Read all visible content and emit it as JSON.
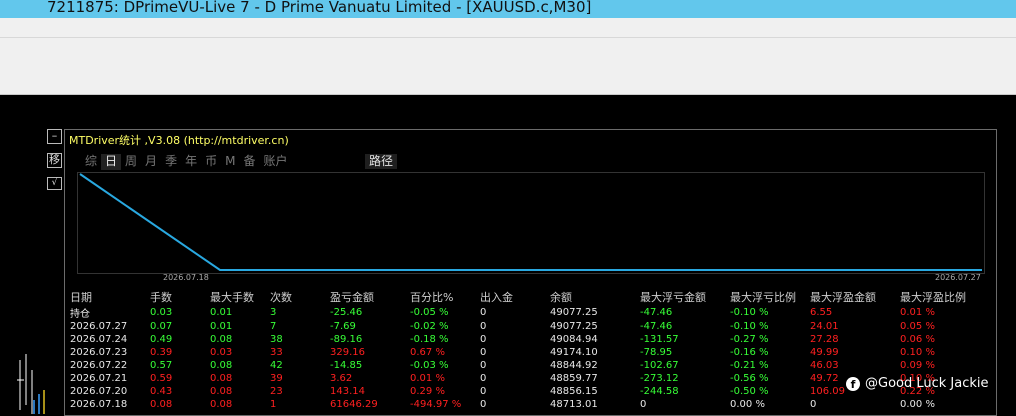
{
  "window": {
    "title": "7211875: DPrimeVU-Live 7 - D Prime Vanuatu Limited - [XAUUSD.c,M30]"
  },
  "side": {
    "minimize": "–",
    "move": "移",
    "check": "√"
  },
  "panel": {
    "title": "MTDriver统计 ,V3.08 (http://mtdriver.cn)",
    "tabs": [
      "综",
      "日",
      "周",
      "月",
      "季",
      "年",
      "币",
      "M",
      "备",
      "账户"
    ],
    "active_tab": "日",
    "path_button": "路径",
    "chart": {
      "start_label": "2026.07.18",
      "end_label": "2026.07.27",
      "line_color": "#29a8e0"
    }
  },
  "table": {
    "headers": [
      "日期",
      "手数",
      "最大手数",
      "次数",
      "盈亏金额",
      "百分比%",
      "出入金",
      "余额",
      "最大浮亏金额",
      "最大浮亏比例",
      "最大浮盈金额",
      "最大浮盈比例"
    ],
    "rows": [
      [
        "持仓",
        "0.03",
        "0.01",
        "3",
        "-25.46",
        "-0.05 %",
        "0",
        "49077.25",
        "-47.46",
        "-0.10 %",
        "6.55",
        "0.01 %"
      ],
      [
        "2026.07.27",
        "0.07",
        "0.01",
        "7",
        "-7.69",
        "-0.02 %",
        "0",
        "49077.25",
        "-47.46",
        "-0.10 %",
        "24.01",
        "0.05 %"
      ],
      [
        "2026.07.24",
        "0.49",
        "0.08",
        "38",
        "-89.16",
        "-0.18 %",
        "0",
        "49084.94",
        "-131.57",
        "-0.27 %",
        "27.28",
        "0.06 %"
      ],
      [
        "2026.07.23",
        "0.39",
        "0.03",
        "33",
        "329.16",
        "0.67 %",
        "0",
        "49174.10",
        "-78.95",
        "-0.16 %",
        "49.99",
        "0.10 %"
      ],
      [
        "2026.07.22",
        "0.57",
        "0.08",
        "42",
        "-14.85",
        "-0.03 %",
        "0",
        "48844.92",
        "-102.67",
        "-0.21 %",
        "46.03",
        "0.09 %"
      ],
      [
        "2026.07.21",
        "0.59",
        "0.08",
        "39",
        "3.62",
        "0.01 %",
        "0",
        "48859.77",
        "-273.12",
        "-0.56 %",
        "49.72",
        "0.10 %"
      ],
      [
        "2026.07.20",
        "0.43",
        "0.08",
        "23",
        "143.14",
        "0.29 %",
        "0",
        "48856.15",
        "-244.58",
        "-0.50 %",
        "106.09",
        "0.22 %"
      ],
      [
        "2026.07.18",
        "0.08",
        "0.08",
        "1",
        "61646.29",
        "-494.97 %",
        "0",
        "48713.01",
        "0",
        "0.00 %",
        "0",
        "0.00 %"
      ]
    ],
    "row_colors": [
      "g",
      "g",
      "g",
      "r",
      "g",
      "r",
      "r",
      "r"
    ]
  },
  "watermark": {
    "text": "@Good Luck Jackie"
  }
}
